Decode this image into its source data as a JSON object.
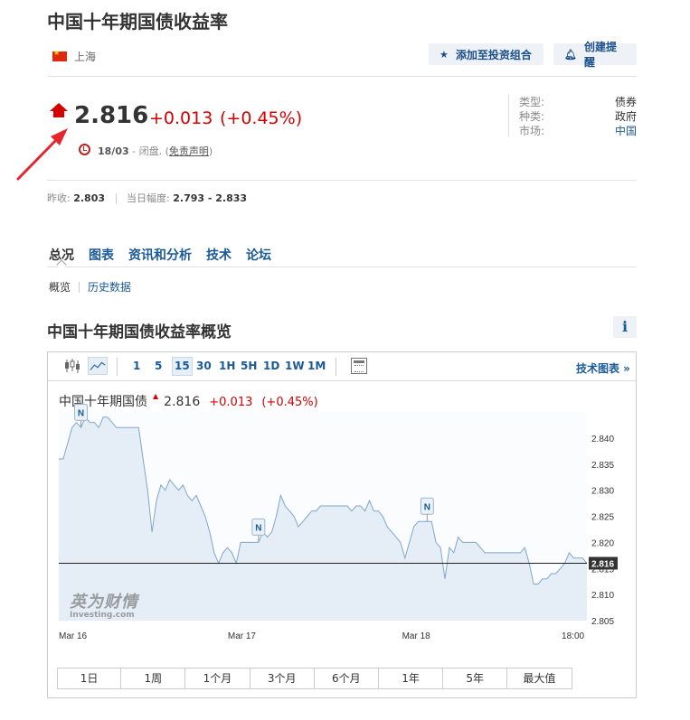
{
  "page": {
    "title": "中国十年期国债收益率",
    "location": "上海",
    "buttons": {
      "portfolio": "添加至投资组合",
      "alert": "创建提醒"
    }
  },
  "quote": {
    "price": "2.816",
    "change": "+0.013",
    "change_pct": "(+0.45%)",
    "date": "18/03",
    "status": " - 闭盘. (",
    "disclaimer": "免责声明",
    "close_paren": ")",
    "direction": "up",
    "up_color": "#d40000"
  },
  "info": {
    "labels": [
      "类型:",
      "种类:",
      "市场:"
    ],
    "values": [
      "债券",
      "政府",
      "中国"
    ]
  },
  "ranges_summary": {
    "prev_label": "昨收:",
    "prev_value": "2.803",
    "day_label": "当日幅度:",
    "day_value": "2.793 - 2.833"
  },
  "tabs": [
    "总况",
    "图表",
    "资讯和分析",
    "技术",
    "论坛"
  ],
  "subtabs": [
    "概览",
    "历史数据"
  ],
  "section_title": "中国十年期国债收益率概览",
  "info_button": "i",
  "chart_toolbar": {
    "timeframes": [
      "1",
      "5",
      "15",
      "30",
      "1H",
      "5H",
      "1D",
      "1W",
      "1M"
    ],
    "active_timeframe": "15",
    "tech_chart_link": "技术图表 »"
  },
  "legend": {
    "name": "中国十年期国债",
    "value": "2.816",
    "change": "+0.013",
    "change_pct": "(+0.45%)"
  },
  "watermark": {
    "cn": "英为财情",
    "en": "Investing.com"
  },
  "range_buttons": [
    "1日",
    "1周",
    "1个月",
    "3个月",
    "6个月",
    "1年",
    "5年",
    "最大值"
  ],
  "chart_data": {
    "type": "area",
    "title": "",
    "xlabel": "",
    "ylabel": "",
    "x_ticks": [
      "Mar 16",
      "Mar 17",
      "Mar 18",
      "18:00"
    ],
    "y_ticks": [
      2.805,
      2.81,
      2.815,
      2.82,
      2.825,
      2.83,
      2.835,
      2.84
    ],
    "ylim": [
      2.805,
      2.845
    ],
    "current_value": 2.816,
    "current_label": "2.816",
    "news_markers": [
      "N",
      "N",
      "N"
    ],
    "series": [
      {
        "values": [
          2.836,
          2.836,
          2.839,
          2.842,
          2.843,
          2.842,
          2.844,
          2.843,
          2.843,
          2.842,
          2.844,
          2.844,
          2.843,
          2.842,
          2.842,
          2.842,
          2.842,
          2.842,
          2.842,
          2.836,
          2.83,
          2.822,
          2.828,
          2.831,
          2.83,
          2.832,
          2.831,
          2.83,
          2.831,
          2.829,
          2.828,
          2.829,
          2.827,
          2.825,
          2.822,
          2.818,
          2.816,
          2.818,
          2.819,
          2.818,
          2.816,
          2.82,
          2.82,
          2.82,
          2.82,
          2.82,
          2.822,
          2.821,
          2.822,
          2.825,
          2.829,
          2.827,
          2.826,
          2.825,
          2.823,
          2.824,
          2.825,
          2.826,
          2.826,
          2.827,
          2.827,
          2.827,
          2.827,
          2.827,
          2.827,
          2.827,
          2.826,
          2.827,
          2.827,
          2.826,
          2.828,
          2.826,
          2.826,
          2.825,
          2.823,
          2.822,
          2.821,
          2.82,
          2.817,
          2.82,
          2.823,
          2.824,
          2.824,
          2.824,
          2.824,
          2.82,
          2.819,
          2.813,
          2.819,
          2.818,
          2.821,
          2.82,
          2.82,
          2.82,
          2.82,
          2.819,
          2.818,
          2.818,
          2.818,
          2.818,
          2.818,
          2.818,
          2.818,
          2.818,
          2.818,
          2.819,
          2.816,
          2.812,
          2.812,
          2.813,
          2.813,
          2.814,
          2.814,
          2.815,
          2.816,
          2.818,
          2.817,
          2.817,
          2.817,
          2.816
        ]
      }
    ],
    "line_color": "#7fa6cc",
    "fill_color": "#e5eef6",
    "grid": false
  }
}
